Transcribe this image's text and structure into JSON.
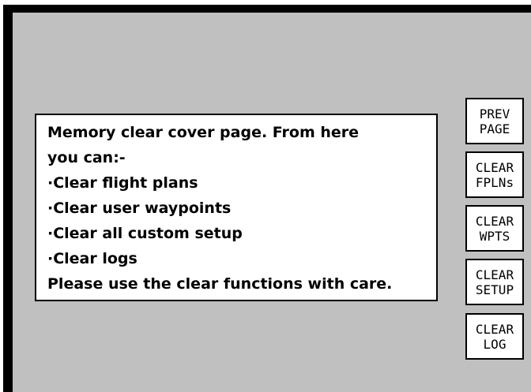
{
  "message": {
    "lines": [
      "Memory clear cover page. From here",
      "you can:-",
      "·Clear flight plans",
      "·Clear user waypoints",
      "·Clear all custom setup",
      "·Clear logs",
      "Please use the clear functions with care."
    ]
  },
  "softkeys": [
    {
      "line1": "PREV",
      "line2": "PAGE"
    },
    {
      "line1": "CLEAR",
      "line2": "FPLNs"
    },
    {
      "line1": "CLEAR",
      "line2": "WPTS"
    },
    {
      "line1": "CLEAR",
      "line2": "SETUP"
    },
    {
      "line1": "CLEAR",
      "line2": "LOG"
    }
  ]
}
